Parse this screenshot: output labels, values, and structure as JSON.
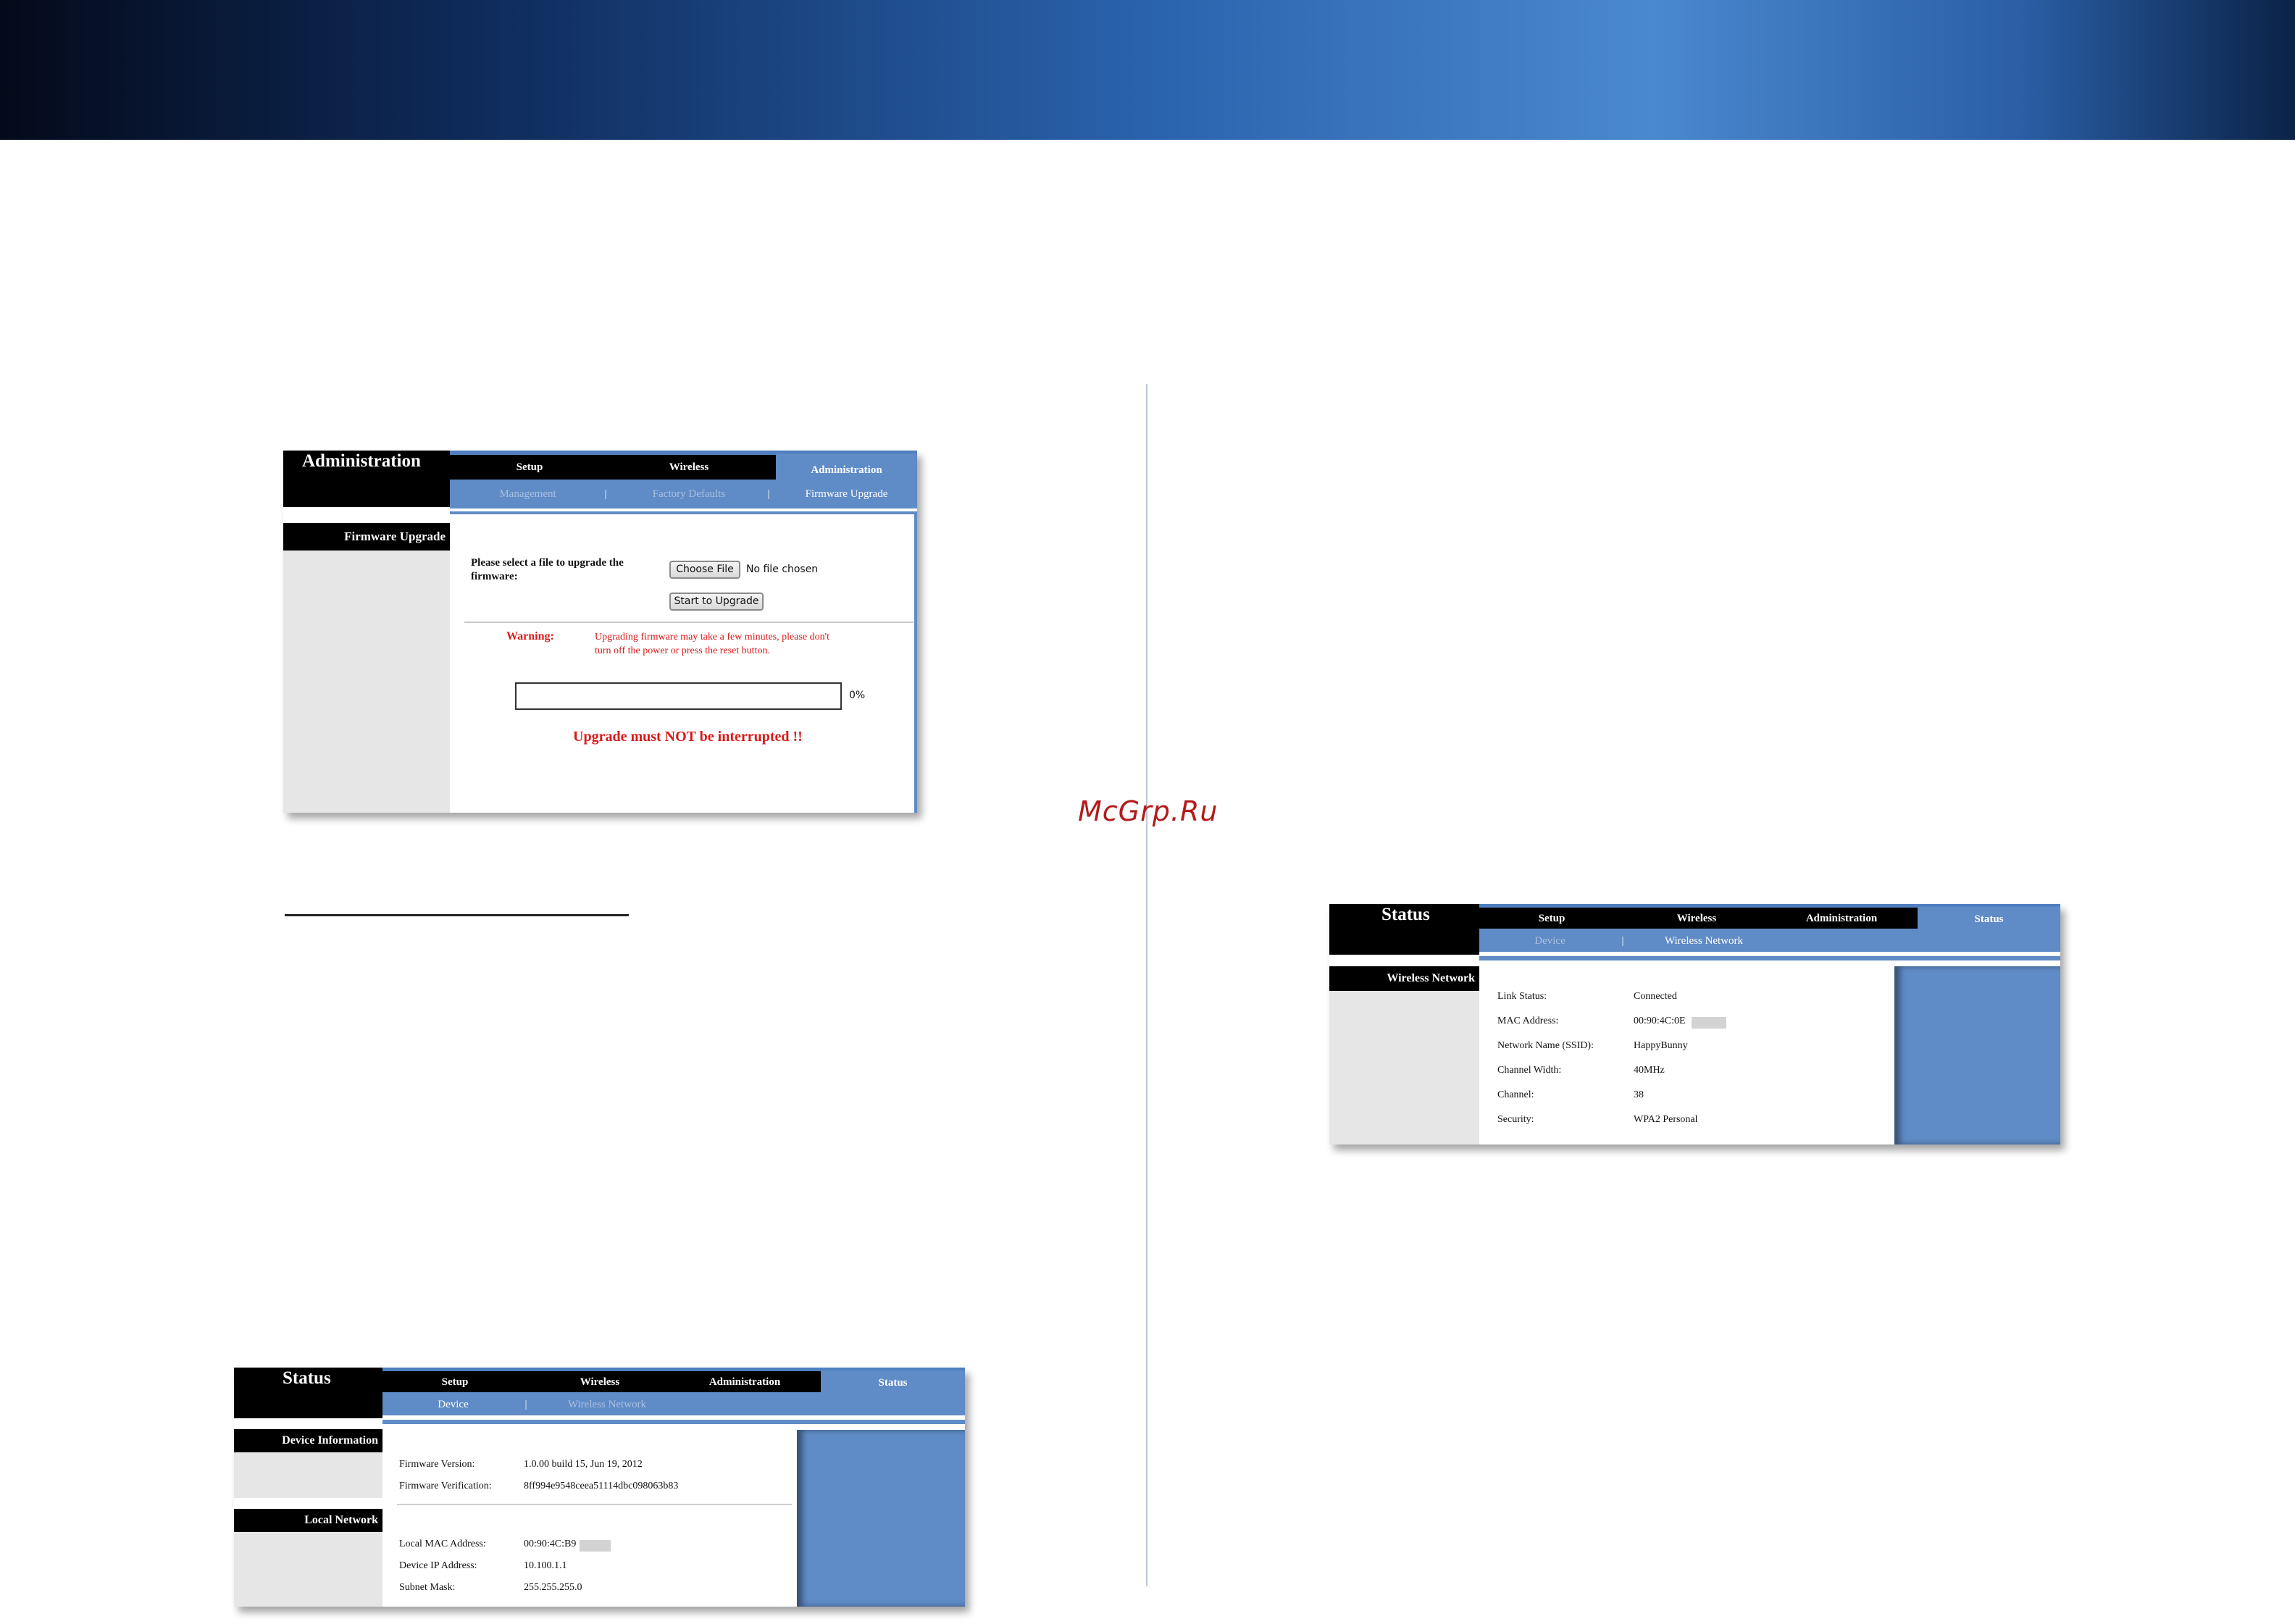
{
  "watermark": "McGrp.Ru",
  "firmware_ui": {
    "title": "Administration",
    "tabs": [
      "Setup",
      "Wireless",
      "Administration"
    ],
    "subtabs": [
      "Management",
      "Factory Defaults",
      "Firmware Upgrade"
    ],
    "section": "Firmware Upgrade",
    "select_label_1": "Please select a file to upgrade the",
    "select_label_2": "firmware:",
    "choose_file": "Choose File",
    "no_file": "No file chosen",
    "start_button": "Start to Upgrade",
    "warning_label": "Warning:",
    "warning_line1": "Upgrading firmware may take a few minutes, please don't",
    "warning_line2": "turn off the power or press the reset button.",
    "progress_text": "0%",
    "progress_value": 0,
    "interrupt_notice": "Upgrade must NOT be interrupted !!",
    "colors": {
      "accent_blue": "#5f8bc6",
      "warning_red": "#d81a1a"
    }
  },
  "status_device_ui": {
    "title": "Status",
    "tabs": [
      "Setup",
      "Wireless",
      "Administration",
      "Status"
    ],
    "subtabs": [
      "Device",
      "Wireless Network"
    ],
    "section_device": "Device Information",
    "section_local": "Local Network",
    "fields": [
      {
        "label": "Firmware Version:",
        "value": "1.0.00 build 15, Jun 19, 2012"
      },
      {
        "label": "Firmware Verification:",
        "value": "8ff994e9548ceea51114dbc098063b83"
      },
      {
        "label": "Local MAC Address:",
        "value": "00:90:4C:B9"
      },
      {
        "label": "Device IP Address:",
        "value": "10.100.1.1"
      },
      {
        "label": "Subnet Mask:",
        "value": "255.255.255.0"
      }
    ]
  },
  "status_wireless_ui": {
    "title": "Status",
    "tabs": [
      "Setup",
      "Wireless",
      "Administration",
      "Status"
    ],
    "subtabs": [
      "Device",
      "Wireless Network"
    ],
    "section": "Wireless Network",
    "fields": [
      {
        "label": "Link Status:",
        "value": "Connected"
      },
      {
        "label": "MAC Address:",
        "value": "00:90:4C:0E"
      },
      {
        "label": "Network Name (SSID):",
        "value": "HappyBunny"
      },
      {
        "label": "Channel Width:",
        "value": "40MHz"
      },
      {
        "label": "Channel:",
        "value": "38"
      },
      {
        "label": "Security:",
        "value": "WPA2 Personal"
      }
    ]
  }
}
